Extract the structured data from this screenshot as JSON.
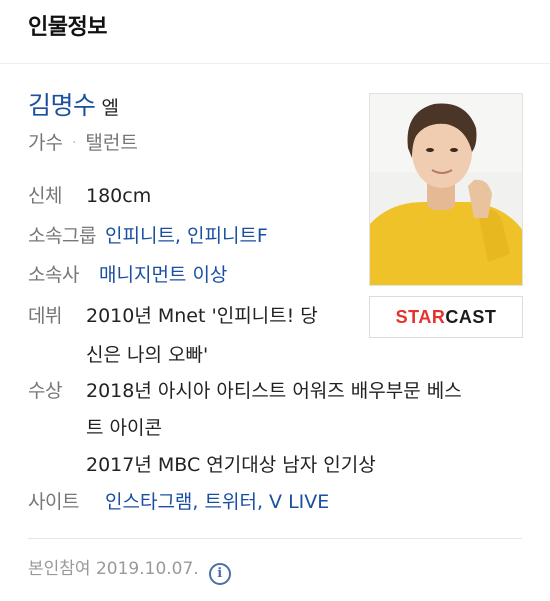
{
  "header": {
    "title": "인물정보"
  },
  "profile": {
    "name": "김명수",
    "alias": "엘",
    "occupations": [
      "가수",
      "탤런트"
    ],
    "separator": "·"
  },
  "details": {
    "height": {
      "label": "신체",
      "value": "180cm"
    },
    "group": {
      "label": "소속그룹",
      "links": [
        "인피니트",
        "인피니트F"
      ],
      "separator": ", "
    },
    "agency": {
      "label": "소속사",
      "link": "매니지먼트 이상"
    },
    "debut": {
      "label": "데뷔",
      "lines": [
        "2010년 Mnet '인피니트! 당",
        "신은 나의 오빠'"
      ]
    },
    "award": {
      "label": "수상",
      "lines": [
        "2018년 아시아 아티스트 어워즈 배우부문 베스",
        "트 아이콘",
        "2017년 MBC 연기대상 남자 인기상"
      ]
    },
    "site": {
      "label": "사이트",
      "links": [
        "인스타그램",
        "트위터",
        "V LIVE"
      ],
      "separator": ", "
    }
  },
  "starcast": {
    "part1": "STAR",
    "part2": "CAST"
  },
  "footer": {
    "text": "본인참여 2019.10.07.",
    "icon": "info-icon",
    "icon_glyph": "i"
  },
  "colors": {
    "link": "#1a4fa0",
    "label": "#777777",
    "starcast_red": "#e5322d",
    "photo_bg": "#f2c62b"
  }
}
